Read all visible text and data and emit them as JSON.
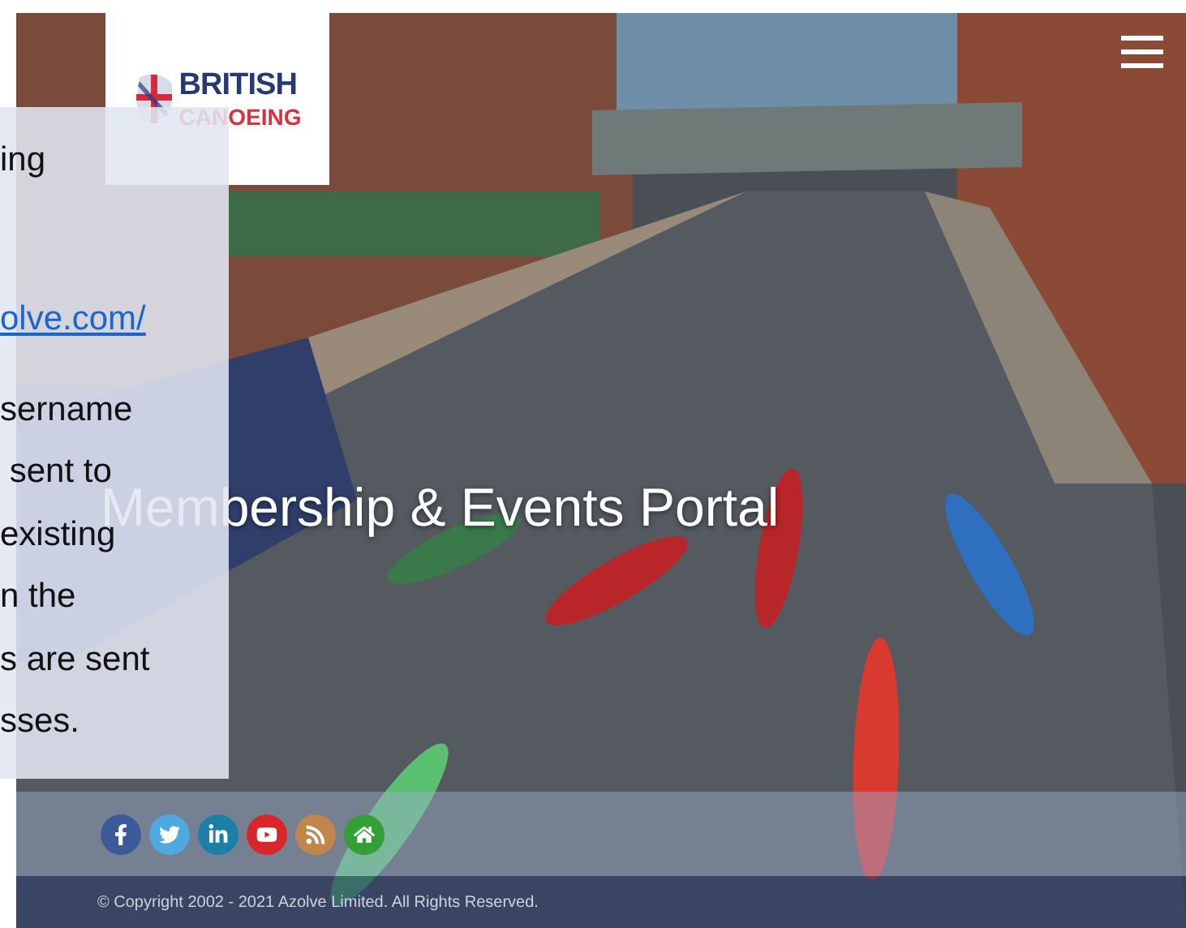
{
  "logo": {
    "line1": "BRITISH",
    "line2": "CANOEING"
  },
  "hero": {
    "title": "Membership & Events Portal"
  },
  "notice": {
    "lines": [
      {
        "kind": "text",
        "text": "ing"
      },
      {
        "kind": "link",
        "text": "olve.com/"
      },
      {
        "kind": "text",
        "text": "sername"
      },
      {
        "kind": "text",
        "text": " sent to"
      },
      {
        "kind": "text",
        "text": "existing"
      },
      {
        "kind": "text",
        "text": "n the"
      },
      {
        "kind": "text",
        "text": "s are sent"
      },
      {
        "kind": "text",
        "text": "sses."
      }
    ]
  },
  "footer": {
    "social": [
      {
        "kind": "facebook",
        "color": "#3b5a9a"
      },
      {
        "kind": "twitter",
        "color": "#4fa8e0"
      },
      {
        "kind": "linkedin",
        "color": "#1b7fa6"
      },
      {
        "kind": "youtube",
        "color": "#d8262b"
      },
      {
        "kind": "rss",
        "color": "#c0864a"
      },
      {
        "kind": "home",
        "color": "#33a035"
      }
    ],
    "copyright": "© Copyright 2002 - 2021 Azolve Limited. All Rights Reserved."
  }
}
